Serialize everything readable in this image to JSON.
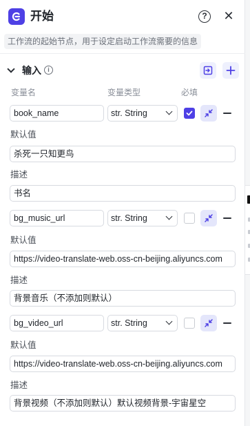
{
  "header": {
    "title": "开始",
    "description": "工作流的起始节点，用于设定启动工作流需要的信息"
  },
  "section": {
    "title": "输入"
  },
  "columns": {
    "name": "变量名",
    "type": "变量类型",
    "required": "必填"
  },
  "labels": {
    "default": "默认值",
    "desc": "描述"
  },
  "variables": [
    {
      "name": "book_name",
      "type": "str. String",
      "required": true,
      "default": "杀死一只知更鸟",
      "description": "书名"
    },
    {
      "name": "bg_music_url",
      "type": "str. String",
      "required": false,
      "default": "https://video-translate-web.oss-cn-beijing.aliyuncs.com",
      "description": "背景音乐（不添加则默认）"
    },
    {
      "name": "bg_video_url",
      "type": "str. String",
      "required": false,
      "default": "https://video-translate-web.oss-cn-beijing.aliyuncs.com",
      "description": "背景视频（不添加则默认）默认视频背景-宇宙星空"
    }
  ],
  "colors": {
    "accent": "#4e40e5",
    "accent_light": "#eef0fd"
  }
}
